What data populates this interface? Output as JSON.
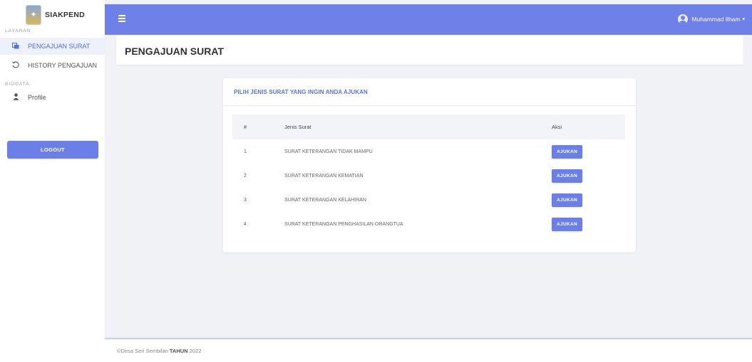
{
  "brand": {
    "name": "SIAKPEND"
  },
  "sidebar": {
    "section_layanan": "LAYANAN",
    "items": [
      {
        "label": "PENGAJUAN SURAT",
        "icon": "inbox-icon"
      },
      {
        "label": "HISTORY PENGAJUAN",
        "icon": "history-icon"
      }
    ],
    "section_biodata": "BIODATA",
    "profile": {
      "label": "Profile",
      "icon": "user-icon"
    },
    "logout_label": "LOGOUT"
  },
  "topbar": {
    "menu_icon": "hamburger-icon",
    "user_name": "Muhammad Ilham",
    "caret": "▾"
  },
  "page": {
    "title": "PENGAJUAN SURAT"
  },
  "card": {
    "title": "PILIH JENIS SURAT YANG INGIN ANDA AJUKAN",
    "columns": [
      "#",
      "Jenis Surat",
      "Aksi"
    ],
    "rows": [
      {
        "no": "1",
        "jenis": "SURAT KETERANGAN TIDAK MAMPU",
        "action": "AJUKAN"
      },
      {
        "no": "2",
        "jenis": "SURAT KETERANGAN KEMATIAN",
        "action": "AJUKAN"
      },
      {
        "no": "3",
        "jenis": "SURAT KETERANGAN KELAHIRAN",
        "action": "AJUKAN"
      },
      {
        "no": "4",
        "jenis": "SURAT KETERANGAN PENGHASILAN ORANGTUA",
        "action": "AJUKAN"
      }
    ]
  },
  "footer": {
    "copyright": "©Desa Seri Sembilan",
    "tahun_label": "TAHUN",
    "year": "2022"
  },
  "colors": {
    "accent": "#6f80e8",
    "button": "#6b7fe6",
    "active_text": "#4e73df"
  }
}
